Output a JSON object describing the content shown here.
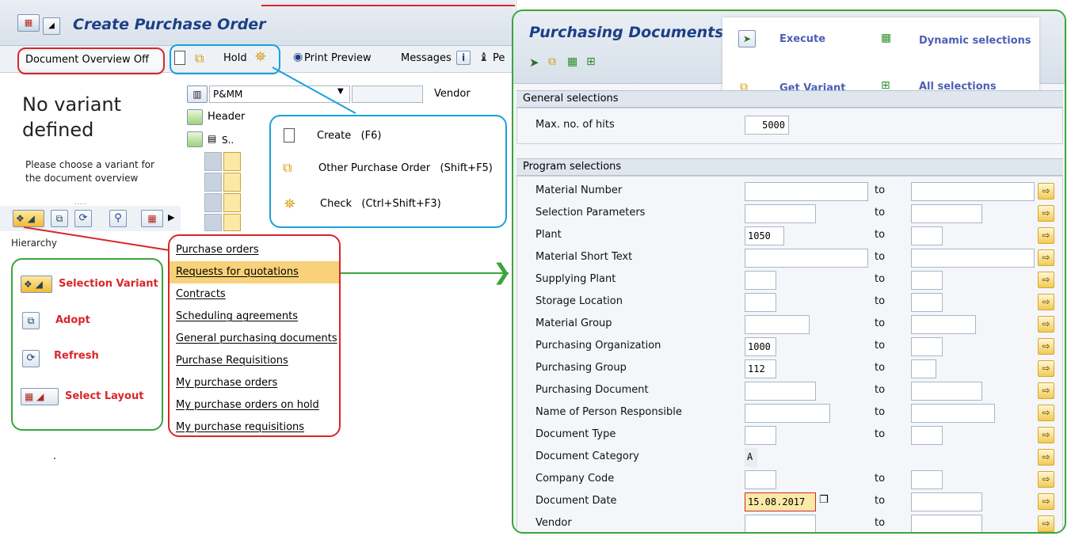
{
  "left": {
    "title": "Create Purchase Order",
    "doc_overview_btn": "Document Overview Off",
    "hold_label": "Hold",
    "print_preview": "Print Preview",
    "messages": "Messages",
    "pe_label": "Pe",
    "no_variant": "No variant defined",
    "choose_variant": "Please choose a variant for the document overview",
    "hierarchy": "Hierarchy",
    "org_field": "P&MM",
    "vendor_label": "Vendor",
    "header_label": "Header",
    "s_col": "S.."
  },
  "blue_callout": {
    "create": "Create   (F6)",
    "other_po": "Other Purchase Order   (Shift+F5)",
    "check": "Check   (Ctrl+Shift+F3)"
  },
  "green_legend": {
    "selection_variant": "Selection Variant",
    "adopt": "Adopt",
    "refresh": "Refresh",
    "select_layout": "Select Layout"
  },
  "menu": {
    "items": [
      "Purchase orders",
      "Requests for quotations",
      "Contracts",
      "Scheduling agreements",
      "General purchasing documents",
      "Purchase Requisitions",
      "My purchase orders",
      "My purchase orders on hold",
      "My purchase requisitions"
    ],
    "selected_index": 1
  },
  "right": {
    "title": "Purchasing Documents",
    "tooltip": {
      "execute": "Execute",
      "dynamic": "Dynamic selections",
      "get_variant": "Get Variant",
      "all": "All selections"
    },
    "general_section": "General selections",
    "max_hits_label": "Max. no. of hits",
    "max_hits_value": "5000",
    "program_section": "Program selections",
    "to_label": "to",
    "rows": [
      {
        "label": "Material Number",
        "value": "",
        "has_to": true
      },
      {
        "label": "Selection Parameters",
        "value": "",
        "has_to": true
      },
      {
        "label": "Plant",
        "value": "1050",
        "has_to": true
      },
      {
        "label": "Material Short Text",
        "value": "",
        "has_to": true
      },
      {
        "label": "Supplying Plant",
        "value": "",
        "has_to": true
      },
      {
        "label": "Storage Location",
        "value": "",
        "has_to": true
      },
      {
        "label": "Material Group",
        "value": "",
        "has_to": true
      },
      {
        "label": "Purchasing Organization",
        "value": "1000",
        "has_to": true
      },
      {
        "label": "Purchasing Group",
        "value": "112",
        "has_to": true
      },
      {
        "label": "Purchasing Document",
        "value": "",
        "has_to": true
      },
      {
        "label": "Name of Person Responsible",
        "value": "",
        "has_to": true
      },
      {
        "label": "Document Type",
        "value": "",
        "has_to": true
      },
      {
        "label": "Document Category",
        "value": "A",
        "has_to": false
      },
      {
        "label": "Company Code",
        "value": "",
        "has_to": true
      },
      {
        "label": "Document Date",
        "value": "15.08.2017",
        "has_to": true
      },
      {
        "label": "Vendor",
        "value": "",
        "has_to": true
      }
    ]
  },
  "colors": {
    "red": "#d9262c",
    "blue": "#1ba1dc",
    "green": "#3aa53a",
    "sap_blue": "#1d3f86"
  }
}
